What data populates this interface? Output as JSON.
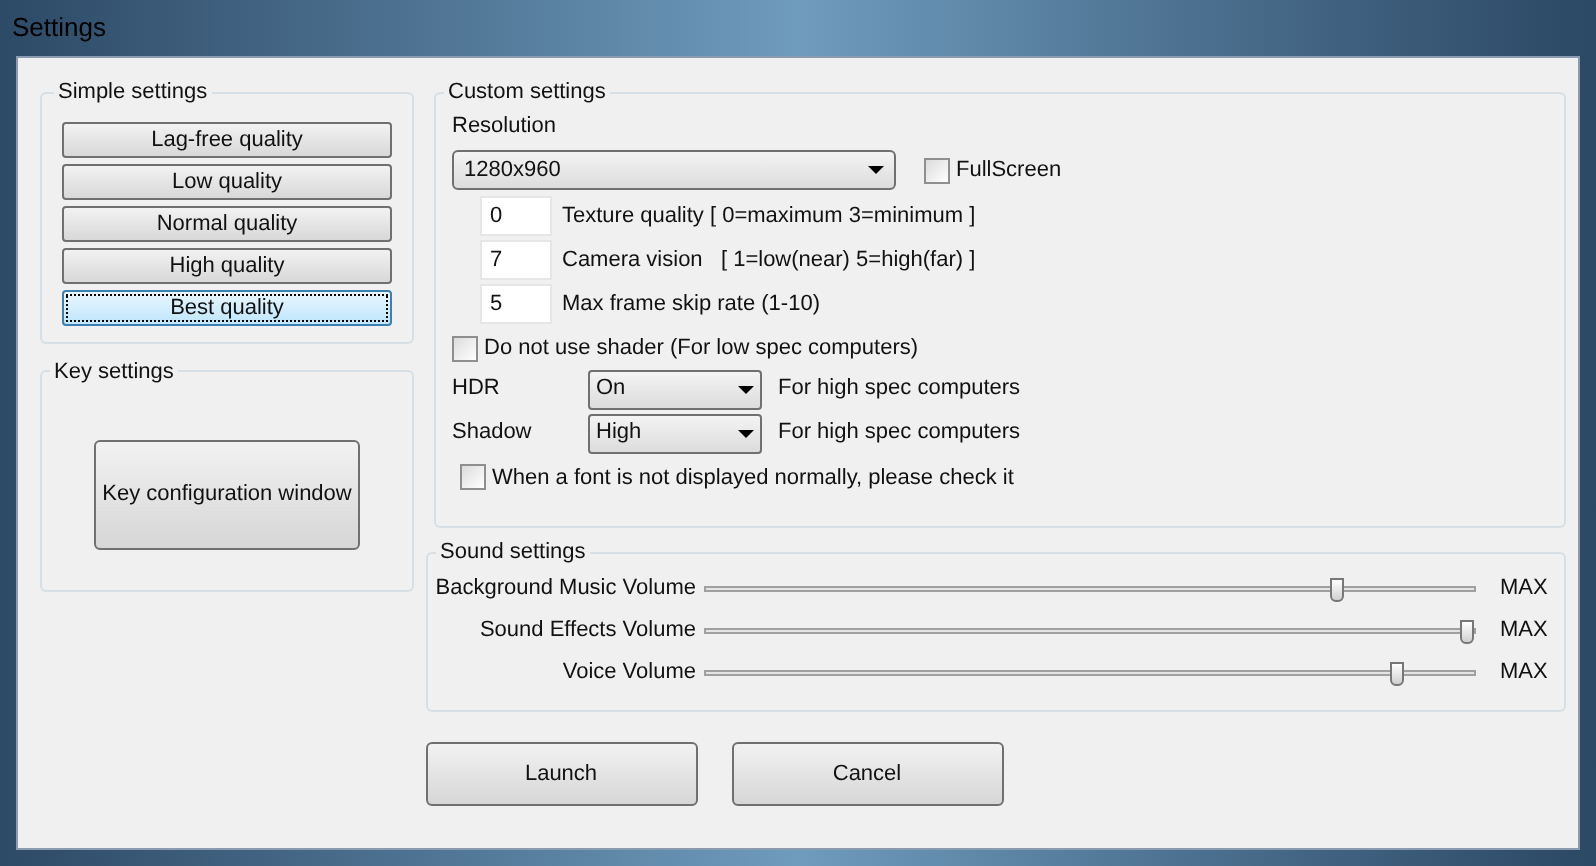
{
  "window": {
    "title": "Settings"
  },
  "simple_settings": {
    "title": "Simple settings",
    "presets": [
      {
        "label": "Lag-free quality",
        "selected": false
      },
      {
        "label": "Low quality",
        "selected": false
      },
      {
        "label": "Normal quality",
        "selected": false
      },
      {
        "label": "High quality",
        "selected": false
      },
      {
        "label": "Best quality",
        "selected": true
      }
    ]
  },
  "key_settings": {
    "title": "Key settings",
    "button": "Key configuration window"
  },
  "custom_settings": {
    "title": "Custom settings",
    "resolution_label": "Resolution",
    "resolution": "1280x960",
    "fullscreen": {
      "label": "FullScreen",
      "checked": false
    },
    "numeric_fields": [
      {
        "value": "0",
        "label": "Texture quality [ 0=maximum 3=minimum ]"
      },
      {
        "value": "7",
        "label": "Camera vision   [ 1=low(near) 5=high(far) ]"
      },
      {
        "value": "5",
        "label": "Max frame skip rate (1-10)"
      }
    ],
    "no_shader": {
      "label": "Do not use shader (For low spec computers)",
      "checked": false
    },
    "dropdowns": [
      {
        "label": "HDR",
        "value": "On",
        "note": "For high spec computers"
      },
      {
        "label": "Shadow",
        "value": "High",
        "note": "For high spec computers"
      }
    ],
    "font_fix": {
      "label": "When a font is not displayed normally, please check it",
      "checked": false
    }
  },
  "sound_settings": {
    "title": "Sound settings",
    "sliders": [
      {
        "label": "Background Music Volume",
        "level": 0.82,
        "reading": "MAX"
      },
      {
        "label": "Sound Effects Volume",
        "level": 0.99,
        "reading": "MAX"
      },
      {
        "label": "Voice Volume",
        "level": 0.9,
        "reading": "MAX"
      }
    ]
  },
  "buttons": [
    "Launch",
    "Cancel"
  ]
}
